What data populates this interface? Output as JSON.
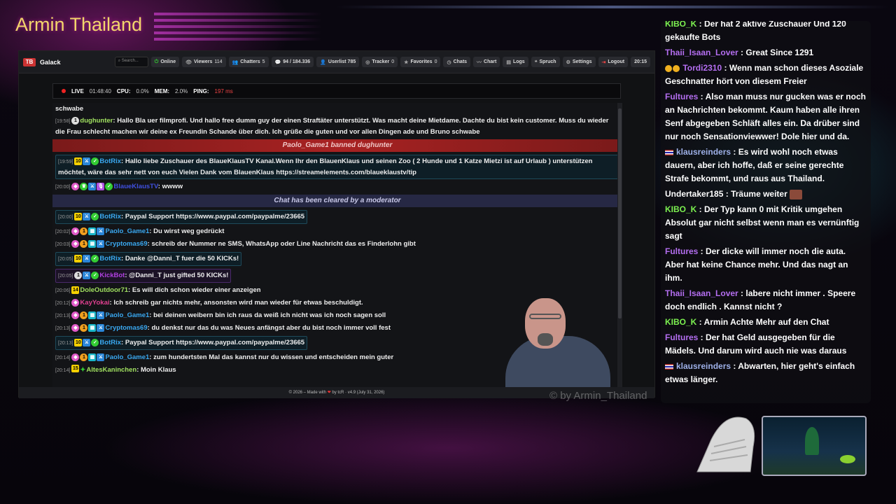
{
  "overlay": {
    "title": "Armin Thailand",
    "watermark": "© by Armin_Thailand"
  },
  "navbar": {
    "logo_mark": "TB",
    "app_name": "Galack",
    "search_placeholder": "Search...",
    "buttons": [
      {
        "label": "Online",
        "icon": "power-icon"
      },
      {
        "label": "Viewers",
        "value": "114",
        "icon": "eye-icon"
      },
      {
        "label": "Chatters",
        "value": "5",
        "icon": "users-icon"
      },
      {
        "label": "94 / 184.336",
        "icon": "chat-bubble-icon"
      },
      {
        "label": "Userlist 785",
        "icon": "user-icon"
      },
      {
        "label": "Tracker",
        "value": "0",
        "icon": "target-icon"
      },
      {
        "label": "Favorites",
        "value": "0",
        "icon": "star-icon"
      },
      {
        "label": "Chats",
        "icon": "clock-icon"
      },
      {
        "label": "Chart",
        "icon": "chart-icon"
      },
      {
        "label": "Logs",
        "icon": "log-icon"
      },
      {
        "label": "Spruch",
        "icon": "quote-icon"
      },
      {
        "label": "Settings",
        "icon": "gear-icon"
      },
      {
        "label": "Logout",
        "icon": "logout-icon"
      }
    ],
    "clock": "20:15"
  },
  "status": {
    "live_label": "LIVE",
    "live_time": "01:48:40",
    "cpu_label": "CPU:",
    "cpu": "0.0%",
    "mem_label": "MEM:",
    "mem": "2.0%",
    "ping_label": "PING:",
    "ping": "197 ms"
  },
  "chat": {
    "lines": [
      {
        "type": "text",
        "text": "schwabe"
      },
      {
        "type": "msg",
        "time": "[19:58]",
        "nick": "dughunter",
        "nick_color": "#a0e060",
        "text": "Hallo Bla uer filmprofi. Und hallo free dumm guy der einen Straftäter unterstützt. Was macht deine Mietdame. Dachte du bist kein customer. Muss du wieder die Frau schlecht machen wir deine ex Freundin Schande über dich. Ich grüße die guten und vor allen Dingen ade und Bruno schwabe"
      },
      {
        "type": "ban",
        "text": "Paolo_Game1 banned dughunter"
      },
      {
        "type": "bot",
        "time": "[19:59]",
        "nick": "BotRix",
        "nick_color": "#3aa8f0",
        "text": "Hallo liebe Zuschauer des BlaueKlausTV Kanal.Wenn Ihr den BlauenKlaus und seinen Zoo ( 2 Hunde und 1 Katze Mietzi ist auf Urlaub ) unterstützen möchtet, wäre das sehr nett von euch Vielen Dank vom BlauenKlaus https://streamelements.com/blaueklaustv/tip"
      },
      {
        "type": "msg",
        "time": "[20:00]",
        "nick": "BlaueKlausTV",
        "nick_color": "#4050e0",
        "text": "wwww"
      },
      {
        "type": "clear",
        "text": "Chat has been cleared by a moderator"
      },
      {
        "type": "bot",
        "time": "[20:00]",
        "nick": "BotRix",
        "nick_color": "#3aa8f0",
        "text": "Paypal Support https://www.paypal.com/paypalme/23665"
      },
      {
        "type": "msg",
        "time": "[20:02]",
        "nick": "Paolo_Game1",
        "nick_color": "#3aa8f0",
        "text": "Du wirst weg gedrückt"
      },
      {
        "type": "msg",
        "time": "[20:03]",
        "nick": "Cryptomas69",
        "nick_color": "#3aa8f0",
        "text": "schreib der Nummer ne SMS, WhatsApp oder Line Nachricht das es Finderlohn gibt"
      },
      {
        "type": "bot",
        "time": "[20:05]",
        "nick": "BotRix",
        "nick_color": "#3aa8f0",
        "text": "Danke @Danni_T fuer die 50 KICKs!"
      },
      {
        "type": "kick",
        "time": "[20:05]",
        "nick": "KickBot",
        "nick_color": "#b040e0",
        "text": "@Danni_T just gifted 50 KICKs!"
      },
      {
        "type": "msg",
        "time": "[20:06]",
        "nick": "DoleOutdoor71",
        "nick_color": "#a0e060",
        "text": "Es will dich schon wieder einer anzeigen"
      },
      {
        "type": "msg",
        "time": "[20:12]",
        "nick": "KayYokai",
        "nick_color": "#e04090",
        "text": "Ich schreib gar nichts mehr, ansonsten wird man wieder für etwas beschuldigt."
      },
      {
        "type": "msg",
        "time": "[20:13]",
        "nick": "Paolo_Game1",
        "nick_color": "#3aa8f0",
        "text": "bei deinen weibern bin ich raus da weiß ich nicht was ich noch sagen soll"
      },
      {
        "type": "msg",
        "time": "[20:13]",
        "nick": "Cryptomas69",
        "nick_color": "#3aa8f0",
        "text": "du denkst nur das du was Neues anfängst aber du bist noch immer voll fest"
      },
      {
        "type": "bot",
        "time": "[20:13]",
        "nick": "BotRix",
        "nick_color": "#3aa8f0",
        "text": "Paypal Support https://www.paypal.com/paypalme/23665"
      },
      {
        "type": "msg",
        "time": "[20:14]",
        "nick": "Paolo_Game1",
        "nick_color": "#3aa8f0",
        "text": "zum hundertsten Mal das kannst nur du wissen und entscheiden mein guter"
      },
      {
        "type": "msg",
        "time": "[20:14]",
        "nick": "AltesKaninchen",
        "nick_color": "#a0e060",
        "text": "Moin Klaus"
      }
    ]
  },
  "footer": {
    "prefix": "© 2026 – Made with",
    "suffix": "by tcR · v4.9 (July 31, 2026)"
  },
  "side_chat": [
    {
      "nick": "KIBO_K",
      "color": "c-green",
      "text": "Der hat 2 aktive Zuschauer Und 120 gekaufte Bots"
    },
    {
      "nick": "Thaii_Isaan_Lover",
      "color": "c-purple",
      "text": "Great Since 1291"
    },
    {
      "nick": "Tordi2310",
      "color": "c-purple",
      "text": "Wenn man schon dieses Asoziale Geschnatter hört von diesem Freier",
      "emotes": true
    },
    {
      "nick": "Fultures",
      "color": "c-purple",
      "text": "Also man muss nur gucken was er noch an Nachrichten bekommt. Kaum haben alle ihren Senf abgegeben Schläft alles ein. Da drüber sind nur noch Sensationviewwer! Dole hier und da."
    },
    {
      "nick": "klausreinders",
      "color": "c-blue",
      "text": "Es wird wohl noch etwas dauern, aber ich hoffe, daß er seine gerechte Strafe bekommt, und raus aus Thailand.",
      "flag": true
    },
    {
      "nick": "Undertaker185",
      "color": "c-white",
      "text": "Träume weiter",
      "sticker": true
    },
    {
      "nick": "KIBO_K",
      "color": "c-green",
      "text": "Der Typ kann 0 mit Kritik umgehen Absolut gar nicht selbst wenn man es vernünftig sagt"
    },
    {
      "nick": "Fultures",
      "color": "c-purple",
      "text": "Der dicke will immer noch die auta. Aber hat keine Chance mehr. Und das nagt an ihm."
    },
    {
      "nick": "Thaii_Isaan_Lover",
      "color": "c-purple",
      "text": "labere nicht immer . Speere doch endlich . Kannst nicht ?"
    },
    {
      "nick": "KIBO_K",
      "color": "c-green",
      "text": "Armin Achte Mehr auf den Chat"
    },
    {
      "nick": "Fultures",
      "color": "c-purple",
      "text": "Der hat Geld ausgegeben für die Mädels. Und darum wird auch nie was daraus"
    },
    {
      "nick": "klausreinders",
      "color": "c-blue",
      "text": "Abwarten, hier geht's einfach etwas länger.",
      "flag": true
    }
  ]
}
